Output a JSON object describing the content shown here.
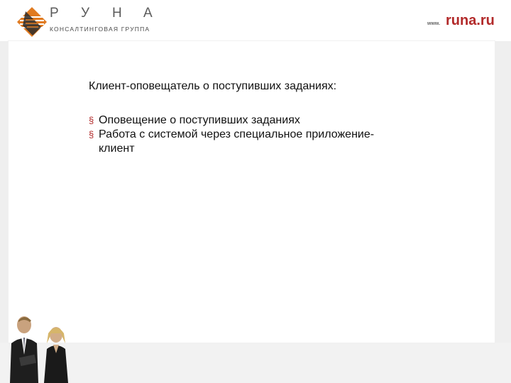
{
  "header": {
    "logo_letters": [
      "Р",
      "У",
      "Н",
      "А"
    ],
    "logo_subtitle": "КОНСАЛТИНГОВАЯ ГРУППА",
    "site_prefix": "www.",
    "site_domain": "runa.ru"
  },
  "slide": {
    "title": "Клиент-оповещатель о поступивших заданиях:",
    "bullets": [
      "Оповещение о поступивших заданиях",
      "Работа с системой через специальное приложение-клиент"
    ]
  },
  "colors": {
    "accent": "#b22a2a",
    "background": "#efefef"
  },
  "icons": {
    "logo": "runa-logo-icon",
    "bullet": "square-bullet-icon",
    "photo": "business-people-photo"
  }
}
